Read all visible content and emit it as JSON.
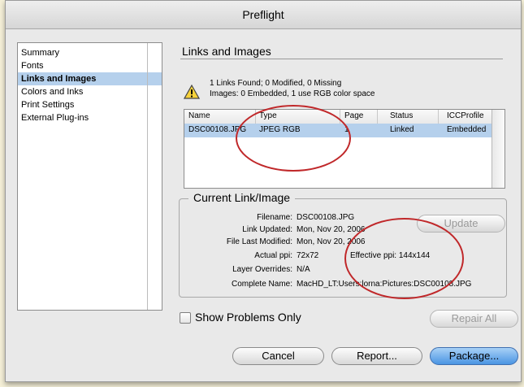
{
  "colors": {
    "accent_yellow": "#ffe54a",
    "selection": "#b5d0ec",
    "annotation_red": "#c0282a"
  },
  "window": {
    "title": "Preflight"
  },
  "sidebar": {
    "items": [
      {
        "label": "Summary",
        "selected": false
      },
      {
        "label": "Fonts",
        "selected": false
      },
      {
        "label": "Links and Images",
        "selected": true
      },
      {
        "label": "Colors and Inks",
        "selected": false
      },
      {
        "label": "Print Settings",
        "selected": false
      },
      {
        "label": "External Plug-ins",
        "selected": false
      }
    ]
  },
  "main": {
    "section_title": "Links and Images",
    "warning_icon": "warning-triangle-icon",
    "info_line1": "1 Links Found; 0 Modified, 0 Missing",
    "info_line2": "Images: 0 Embedded, 1 use RGB color space",
    "table": {
      "columns": [
        "Name",
        "Type",
        "Page",
        "Status",
        "ICCProfile"
      ],
      "rows": [
        {
          "name": "DSC00108.JPG",
          "type": "JPEG RGB",
          "page": "1",
          "status": "Linked",
          "icc": "Embedded"
        }
      ]
    },
    "current": {
      "title": "Current Link/Image",
      "filename_label": "Filename:",
      "filename": "DSC00108.JPG",
      "link_updated_label": "Link Updated:",
      "link_updated": "Mon, Nov 20, 2006",
      "file_modified_label": "File Last Modified:",
      "file_modified": "Mon, Nov 20, 2006",
      "actual_ppi_label": "Actual ppi:",
      "actual_ppi": "72x72",
      "effective_ppi": "Effective ppi: 144x144",
      "layer_overrides_label": "Layer Overrides:",
      "layer_overrides": "N/A",
      "complete_name_label": "Complete Name:",
      "complete_name": "MacHD_LT:Users:lorna:Pictures:DSC00108.JPG",
      "update_label": "Update"
    },
    "show_problems_label": "Show Problems Only",
    "repair_all_label": "Repair All"
  },
  "footer": {
    "cancel_label": "Cancel",
    "report_label": "Report...",
    "package_label": "Package..."
  }
}
